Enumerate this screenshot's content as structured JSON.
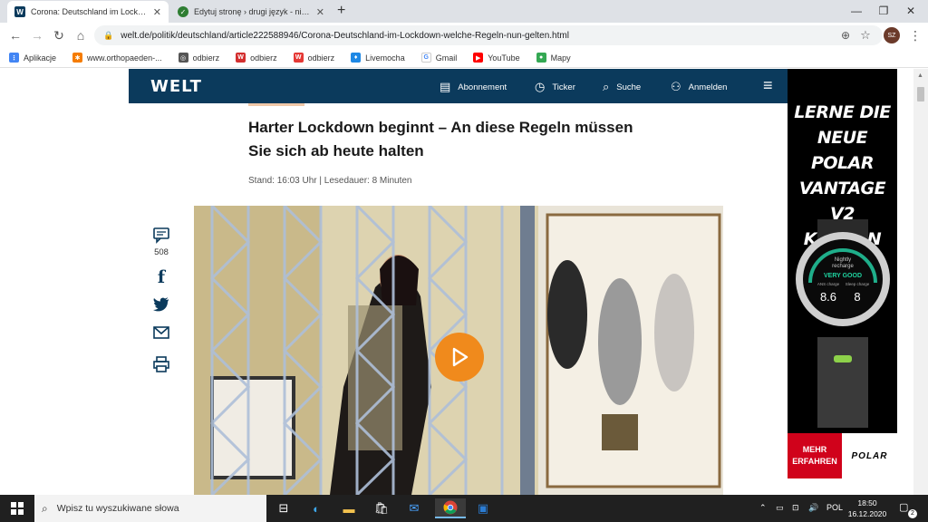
{
  "tabs": [
    {
      "title": "Corona: Deutschland im Lockdown",
      "favicon": "W",
      "active": true
    },
    {
      "title": "Edytuj stronę › drugi język - niem",
      "favicon": "✓",
      "active": false
    }
  ],
  "toolbar": {
    "url": "welt.de/politik/deutschland/article222588946/Corona-Deutschland-im-Lockdown-welche-Regeln-nun-gelten.html",
    "avatar": "SZ"
  },
  "bookmarks": [
    {
      "label": "Aplikacje",
      "color": "#4285f4"
    },
    {
      "label": "www.orthopaeden-...",
      "color": "#f57c00"
    },
    {
      "label": "odbierz",
      "color": "#555555"
    },
    {
      "label": "odbierz",
      "color": "#d32f2f"
    },
    {
      "label": "odbierz",
      "color": "#e53935"
    },
    {
      "label": "Livemocha",
      "color": "#1e88e5"
    },
    {
      "label": "Gmail",
      "color": "#4285f4"
    },
    {
      "label": "YouTube",
      "color": "#ff0000"
    },
    {
      "label": "Mapy",
      "color": "#34a853"
    }
  ],
  "welt": {
    "logo": "WELT",
    "nav": {
      "abonnement": "Abonnement",
      "ticker": "Ticker",
      "suche": "Suche",
      "anmelden": "Anmelden"
    },
    "article": {
      "headline_line1": "Harter Lockdown beginnt – An diese Regeln müssen",
      "headline_line2": "Sie sich ab heute halten",
      "stand": "Stand: 16:03 Uhr | Lesedauer: 8 Minuten",
      "comments": "508"
    }
  },
  "ad": {
    "line1": "LERNE DIE",
    "line2": "NEUE POLAR",
    "line3": "VANTAGE V2",
    "line4": "KENNEN",
    "cta_line1": "MEHR",
    "cta_line2": "ERFAHREN",
    "brand": "POLAR",
    "watch": {
      "line1": "Nightly",
      "line2": "recharge",
      "status": "VERY GOOD",
      "left_label": "ANS charge",
      "right_label": "Sleep charge",
      "left_value": "8.6",
      "right_value": "8"
    }
  },
  "taskbar": {
    "search_placeholder": "Wpisz tu wyszukiwane słowa",
    "lang": "POL",
    "time": "18:50",
    "date": "16.12.2020",
    "notifications": "2"
  },
  "colors": {
    "welt_navy": "#0b3a5c",
    "play_orange": "#f08a1c",
    "ad_red": "#d0021b"
  }
}
